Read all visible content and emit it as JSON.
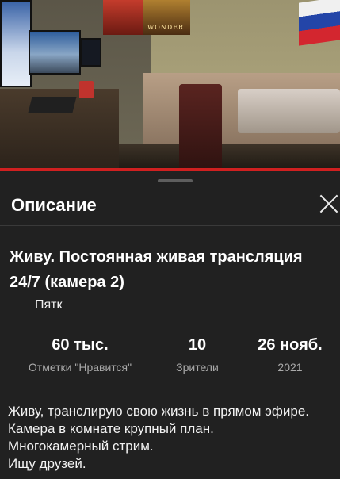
{
  "panel": {
    "title": "Описание",
    "video_title": "Живу. Постоянная живая трансляция 24/7 (камера 2)",
    "channel_name": "Пятк"
  },
  "stats": [
    {
      "value": "60 тыс.",
      "label": "Отметки \"Нравится\""
    },
    {
      "value": "10",
      "label": "Зрители"
    },
    {
      "value": "26 нояб.",
      "label": "2021"
    }
  ],
  "description_lines": [
    "Живу, транслирую свою жизнь в прямом эфире.",
    "Камера в комнате крупный план.",
    "Многокамерный стрим.",
    "Ищу друзей."
  ],
  "poster_text": "WONDER",
  "colors": {
    "panel_bg": "#212121",
    "progress": "#d02020",
    "secondary_text": "#aaaaaa"
  }
}
